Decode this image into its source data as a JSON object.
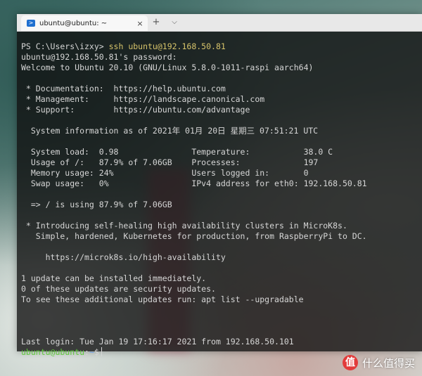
{
  "window": {
    "tab_icon": "powershell-icon",
    "tab_title": "ubuntu@ubuntu: ~",
    "close_glyph": "×",
    "new_tab_glyph": "+",
    "dropdown_glyph": "⌵"
  },
  "terminal": {
    "prompt_ps": "PS C:\\Users\\izxy> ",
    "cmd_ssh": "ssh ubuntu@192.168.50.81",
    "lines": {
      "l2": "ubuntu@192.168.50.81's password:",
      "l3": "Welcome to Ubuntu 20.10 (GNU/Linux 5.8.0-1011-raspi aarch64)",
      "l5": " * Documentation:  https://help.ubuntu.com",
      "l6": " * Management:     https://landscape.canonical.com",
      "l7": " * Support:        https://ubuntu.com/advantage",
      "l9": "  System information as of 2021年 01月 20日 星期三 07:51:21 UTC",
      "l11": "  System load:  0.98               Temperature:           38.0 C",
      "l12": "  Usage of /:   87.9% of 7.06GB    Processes:             197",
      "l13": "  Memory usage: 24%                Users logged in:       0",
      "l14": "  Swap usage:   0%                 IPv4 address for eth0: 192.168.50.81",
      "l16": "  => / is using 87.9% of 7.06GB",
      "l18": " * Introducing self-healing high availability clusters in MicroK8s.",
      "l19": "   Simple, hardened, Kubernetes for production, from RaspberryPi to DC.",
      "l21": "     https://microk8s.io/high-availability",
      "l23": "1 update can be installed immediately.",
      "l24": "0 of these updates are security updates.",
      "l25": "To see these additional updates run: apt list --upgradable",
      "l29": "Last login: Tue Jan 19 17:16:17 2021 from 192.168.50.101"
    },
    "final_prompt": {
      "user_host": "ubuntu@ubuntu",
      "sep": ":",
      "path": "~",
      "dollar": "$"
    }
  },
  "watermark": {
    "logo": "值",
    "text": "什么值得买"
  }
}
